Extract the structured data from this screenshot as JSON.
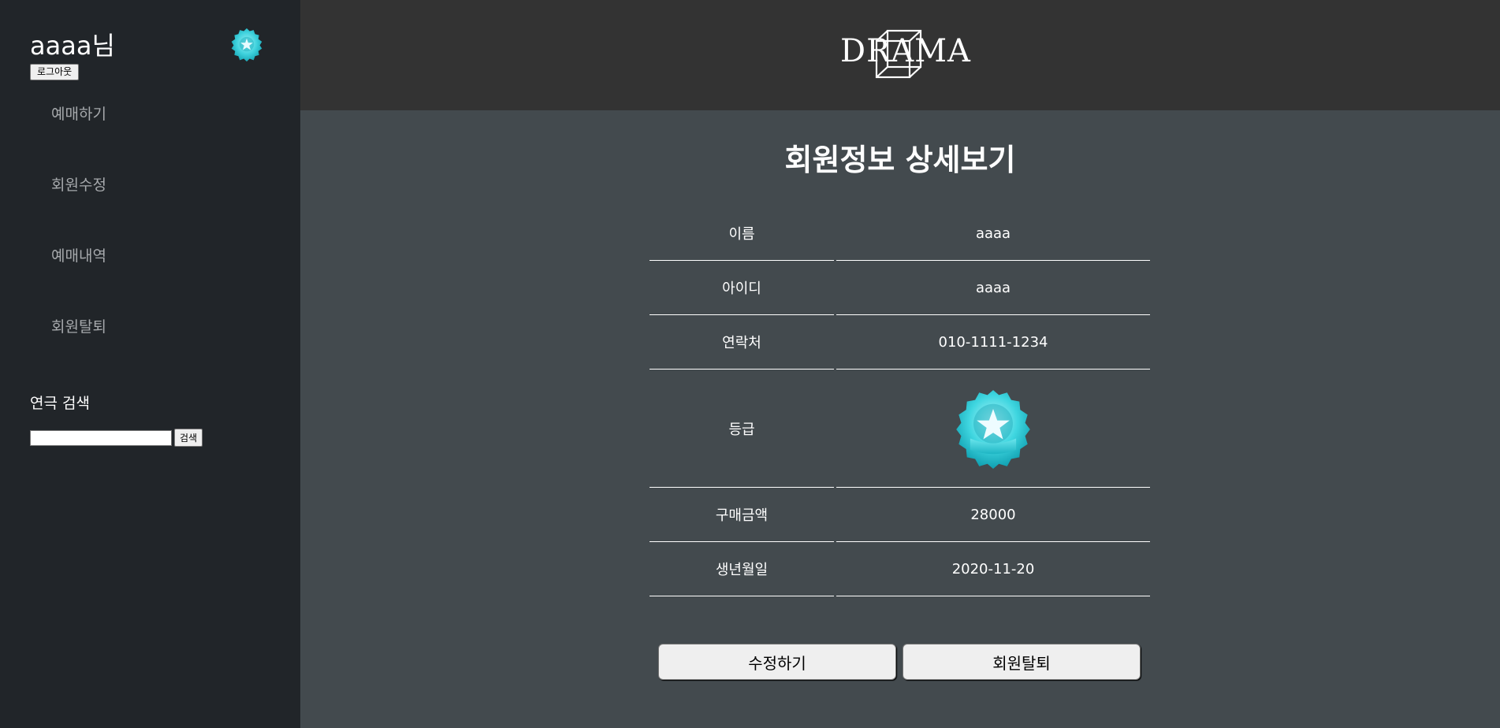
{
  "sidebar": {
    "username": "aaaa님",
    "logout_label": "로그아웃",
    "nav_items": [
      {
        "label": "예매하기"
      },
      {
        "label": "회원수정"
      },
      {
        "label": "예매내역"
      },
      {
        "label": "회원탈퇴"
      }
    ],
    "search_title": "연극 검색",
    "search_value": "",
    "search_button": "검색",
    "badge_icon": "star-medal-icon"
  },
  "header": {
    "logo_text": "DRAMA",
    "logo_icon": "cube-icon"
  },
  "main": {
    "title": "회원정보 상세보기",
    "rows": [
      {
        "label": "이름",
        "value": "aaaa"
      },
      {
        "label": "아이디",
        "value": "aaaa"
      },
      {
        "label": "연락처",
        "value": "010-1111-1234"
      },
      {
        "label": "등급",
        "value_icon": "star-medal-icon"
      },
      {
        "label": "구매금액",
        "value": "28000"
      },
      {
        "label": "생년월일",
        "value": "2020-11-20"
      }
    ],
    "edit_button": "수정하기",
    "withdraw_button": "회원탈퇴"
  },
  "colors": {
    "sidebar_bg": "#212529",
    "header_bg": "#333333",
    "main_bg": "#434a4e",
    "medal_teal": "#38d6e0"
  }
}
